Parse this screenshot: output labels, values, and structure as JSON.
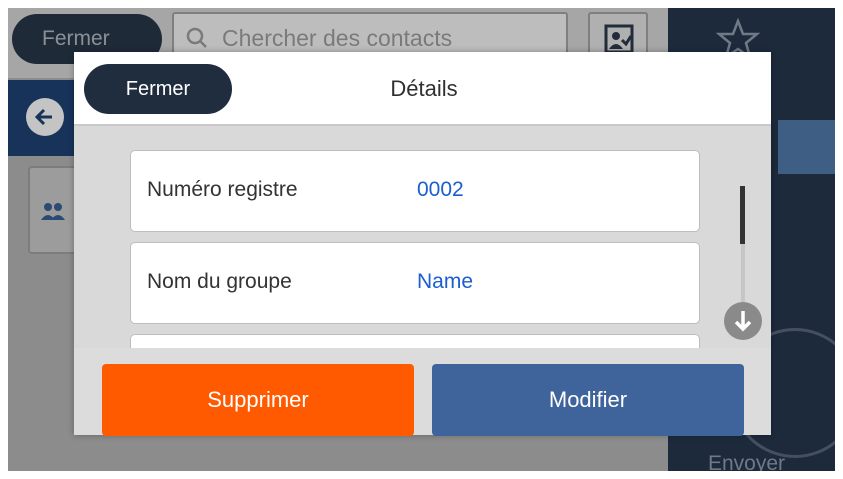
{
  "background": {
    "close_label": "Fermer",
    "search_placeholder": "Chercher des contacts",
    "send_label": "Envoyer",
    "icons": [
      "search-icon",
      "contact-select-icon",
      "back-arrow-icon",
      "group-icon",
      "star-icon"
    ]
  },
  "modal": {
    "close_label": "Fermer",
    "title": "Détails",
    "rows": [
      {
        "label": "Numéro registre",
        "value": "0002"
      },
      {
        "label": "Nom du groupe",
        "value": "Name"
      }
    ],
    "delete_label": "Supprimer",
    "edit_label": "Modifier"
  },
  "colors": {
    "delete": "#ff5a00",
    "edit": "#3f639b",
    "value_text": "#1a5ecf",
    "close_button": "#1f2d3e"
  }
}
